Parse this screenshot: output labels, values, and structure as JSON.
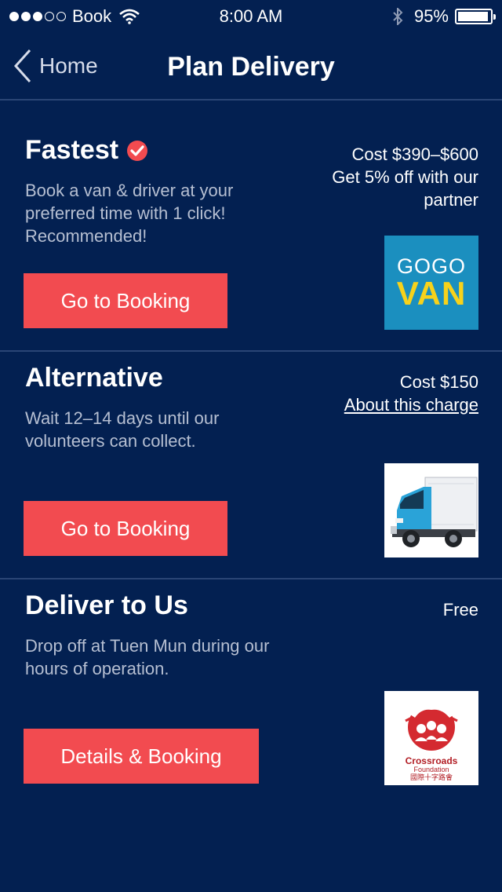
{
  "status_bar": {
    "carrier": "Book",
    "time": "8:00 AM",
    "battery_percent": "95%",
    "battery_level": 0.95,
    "signal_bars_filled": 3,
    "signal_bars_total": 5
  },
  "nav": {
    "back_label": "Home",
    "title": "Plan Delivery"
  },
  "options": [
    {
      "title": "Fastest",
      "description": "Book a van & driver at your preferred time with 1 click! Recommended!",
      "cost": "Cost $390–$600",
      "note": "Get 5% off with our partner",
      "button_label": "Go to Booking",
      "logo": {
        "line1": "GOGO",
        "line2": "VAN"
      }
    },
    {
      "title": "Alternative",
      "description": "Wait 12–14 days until our volunteers can collect.",
      "cost": "Cost $150",
      "link": "About this charge",
      "button_label": "Go to Booking",
      "logo_icon": "delivery-truck-icon"
    },
    {
      "title": "Deliver to Us",
      "description": "Drop off at Tuen Mun during our hours of operation.",
      "cost": "Free",
      "button_label": "Details & Booking",
      "logo": {
        "name": "Crossroads",
        "sub": "Foundation",
        "chinese": "國際十字路會"
      }
    }
  ],
  "colors": {
    "background": "#032051",
    "accent_button": "#f24b50",
    "check_badge": "#f24b50",
    "divider": "#2a4575",
    "gogovan_blue": "#1b8fbf",
    "gogovan_yellow": "#f7d21b",
    "crossroads_red": "#b21d24"
  }
}
